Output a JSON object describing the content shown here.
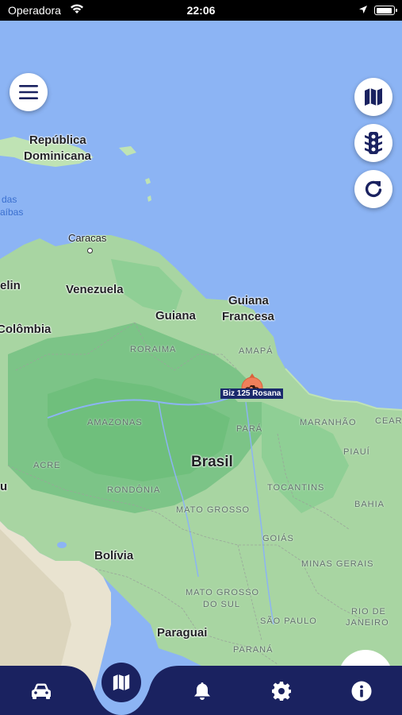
{
  "status_bar": {
    "carrier": "Operadora",
    "time": "22:06"
  },
  "map": {
    "countries": {
      "republica_dominicana_1": "República",
      "republica_dominicana_2": "Dominicana",
      "venezuela": "Venezuela",
      "colombia": "Colômbia",
      "guiana": "Guiana",
      "guiana_francesa_1": "Guiana",
      "guiana_francesa_2": "Francesa",
      "brasil": "Brasil",
      "bolivia": "Bolívia",
      "paraguai": "Paraguai",
      "peru_partial": "u",
      "chile_partial": "elin"
    },
    "cities": {
      "caracas": "Caracas"
    },
    "seas": {
      "caribe_1": "das",
      "caribe_2": "aíbas"
    },
    "states": {
      "roraima": "RORAIMA",
      "amapa": "AMAPÁ",
      "amazonas": "AMAZONAS",
      "para": "PARÁ",
      "maranhao": "MARANHÃO",
      "ceara": "CEAR",
      "piaui": "PIAUÍ",
      "acre": "ACRE",
      "rondonia": "RONDÔNIA",
      "tocantins": "TOCANTINS",
      "bahia": "BAHIA",
      "mato_grosso": "MATO GROSSO",
      "goias": "GOIÁS",
      "minas_gerais": "MINAS GERAIS",
      "mato_grosso_do_sul_1": "MATO GROSSO",
      "mato_grosso_do_sul_2": "DO SUL",
      "sao_paulo": "SÃO PAULO",
      "rio_de_janeiro_1": "RIO DE",
      "rio_de_janeiro_2": "JANEIRO",
      "parana": "PARANÁ"
    },
    "vehicle_label": "Biz 125 Rosana"
  },
  "icons": {
    "menu": "menu-icon",
    "map_type": "map-icon",
    "traffic": "traffic-light-icon",
    "refresh": "refresh-icon",
    "car": "car-icon",
    "map_nav": "map-icon",
    "bell": "bell-icon",
    "settings": "gear-icon",
    "info": "info-icon"
  },
  "colors": {
    "primary": "#1a2260",
    "ocean": "#8cb4f4",
    "land": "#a8d5a2",
    "forest": "#6fbf7c",
    "marker": "#f07f5a"
  }
}
